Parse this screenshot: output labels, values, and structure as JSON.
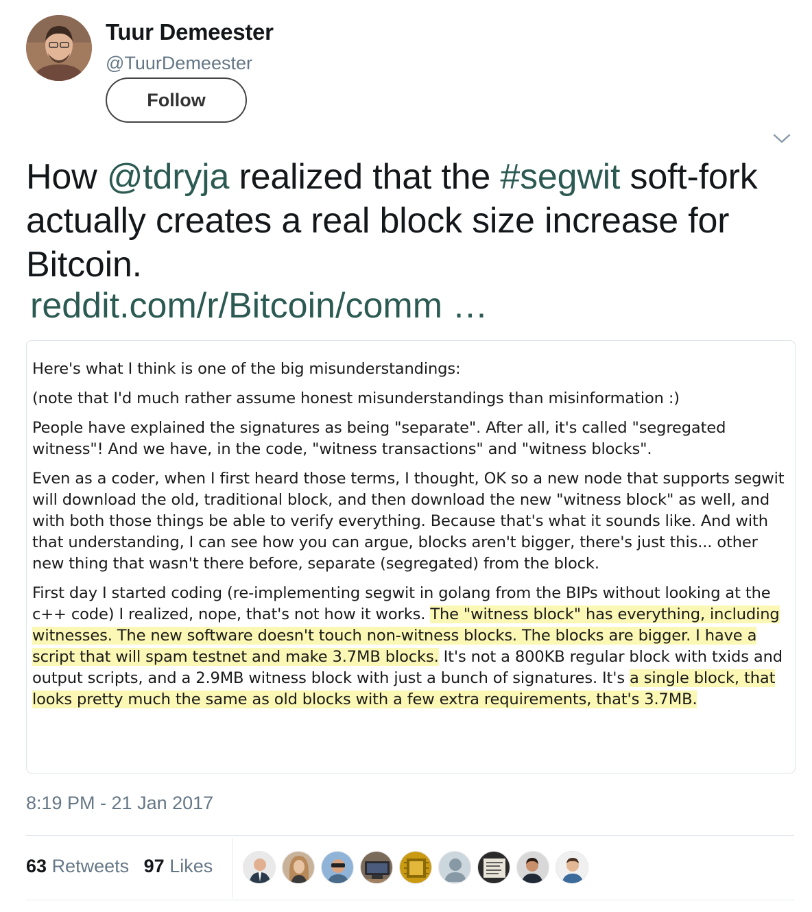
{
  "author": {
    "name": "Tuur Demeester",
    "handle": "@TuurDemeester"
  },
  "follow_label": "Follow",
  "tweet": {
    "part1": "How ",
    "mention": "@tdryja",
    "part2": " realized that the ",
    "hashtag": "#segwit",
    "part3": " soft-fork actually creates a real block size increase for Bitcoin.",
    "link": "reddit.com/r/Bitcoin/comm  …"
  },
  "card": {
    "p1": "Here's what I think is one of the big misunderstandings:",
    "p2": "(note that I'd much rather assume honest misunderstandings than misinformation :)",
    "p3": "People have explained the signatures as being \"separate\". After all, it's called \"segregated witness\"! And we have, in the code, \"witness transactions\" and \"witness blocks\".",
    "p4": "Even as a coder, when I first heard those terms, I thought, OK so a new node that supports segwit will download the old, traditional block, and then download the new \"witness block\" as well, and with both those things be able to verify everything. Because that's what it sounds like. And with that understanding, I can see how you can argue, blocks aren't bigger, there's just this... other new thing that wasn't there before, separate (segregated) from the block.",
    "p5a": "First day I started coding (re-implementing segwit in golang from the BIPs without looking at the c++ code) I realized, nope, that's not how it works. ",
    "p5b": "The \"witness block\" has everything, including witnesses. The new software doesn't touch non-witness blocks. The blocks are bigger. I have a script that will spam testnet and make 3.7MB blocks.",
    "p5c": " It's not a 800KB regular block with txids and output scripts, and a 2.9MB witness block with just a bunch of signatures. It's ",
    "p5d": "a single block, that looks pretty much the same as old blocks with a few extra requirements, that's 3.7MB.",
    "highlight_color": "#fbf7b4"
  },
  "timestamp": "8:19 PM - 21 Jan 2017",
  "stats": {
    "retweets_count": "63",
    "retweets_label": "Retweets",
    "likes_count": "97",
    "likes_label": "Likes"
  },
  "colors": {
    "link": "#2b5a52",
    "meta": "#657786",
    "text": "#14171a"
  }
}
